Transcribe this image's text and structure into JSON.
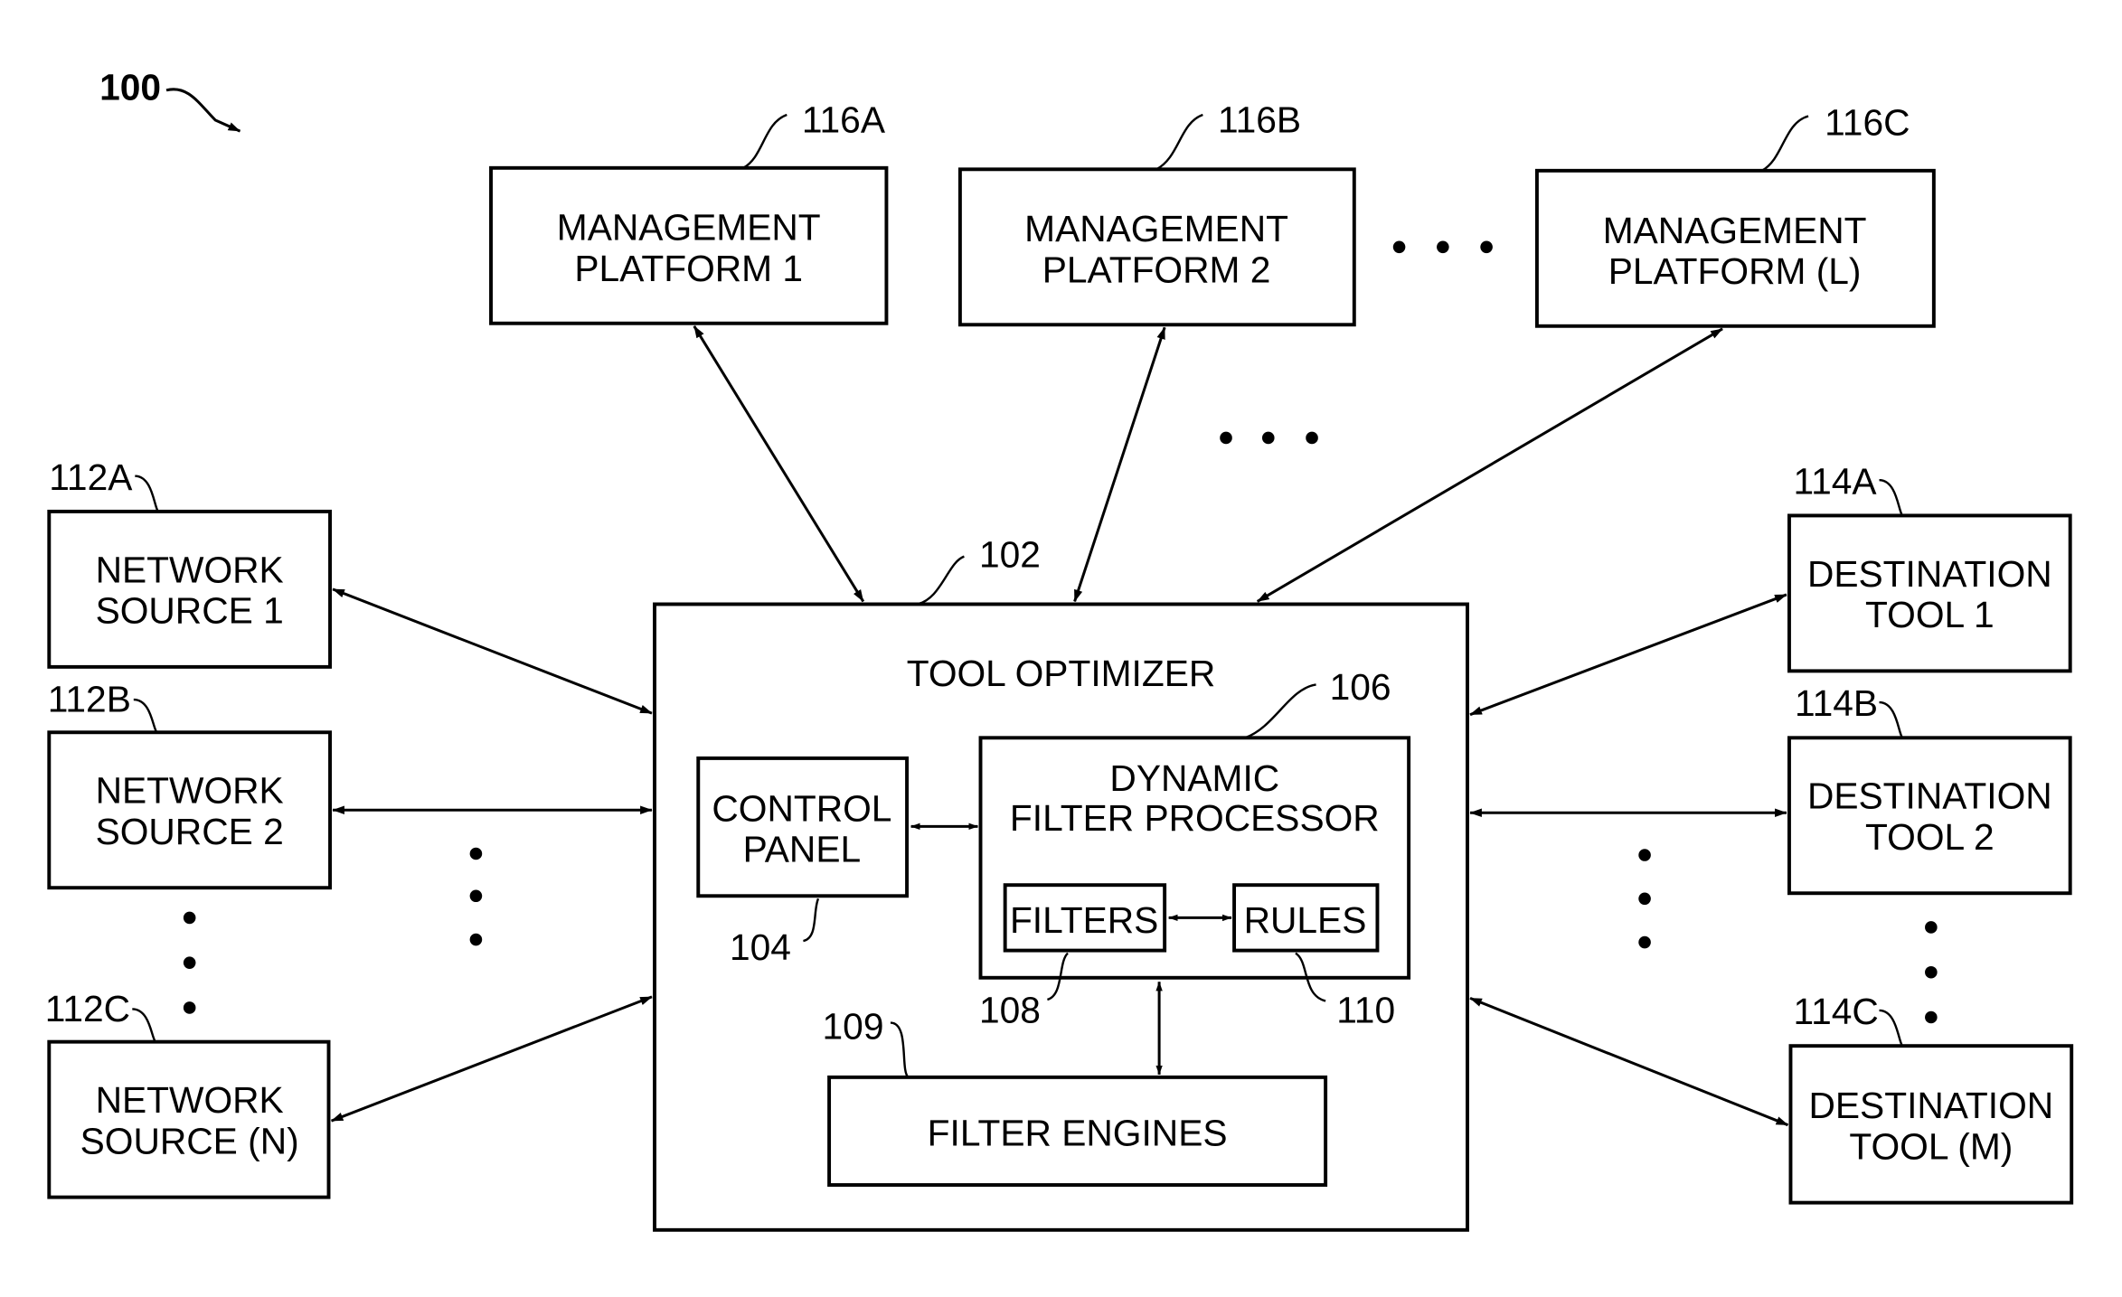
{
  "figure": {
    "ref": "100",
    "colors": {
      "stroke": "#000000",
      "background": "#ffffff"
    }
  },
  "management_platforms": [
    {
      "ref": "116A",
      "line1": "MANAGEMENT",
      "line2": "PLATFORM 1"
    },
    {
      "ref": "116B",
      "line1": "MANAGEMENT",
      "line2": "PLATFORM 2"
    },
    {
      "ref": "116C",
      "line1": "MANAGEMENT",
      "line2": "PLATFORM (L)"
    }
  ],
  "network_sources": [
    {
      "ref": "112A",
      "line1": "NETWORK",
      "line2": "SOURCE 1"
    },
    {
      "ref": "112B",
      "line1": "NETWORK",
      "line2": "SOURCE 2"
    },
    {
      "ref": "112C",
      "line1": "NETWORK",
      "line2": "SOURCE (N)"
    }
  ],
  "destination_tools": [
    {
      "ref": "114A",
      "line1": "DESTINATION",
      "line2": "TOOL 1"
    },
    {
      "ref": "114B",
      "line1": "DESTINATION",
      "line2": "TOOL 2"
    },
    {
      "ref": "114C",
      "line1": "DESTINATION",
      "line2": "TOOL (M)"
    }
  ],
  "tool_optimizer": {
    "ref": "102",
    "title": "TOOL OPTIMIZER",
    "control_panel": {
      "ref": "104",
      "line1": "CONTROL",
      "line2": "PANEL"
    },
    "dynamic_filter_processor": {
      "ref": "106",
      "line1": "DYNAMIC",
      "line2": "FILTER PROCESSOR",
      "filters": {
        "ref": "108",
        "label": "FILTERS"
      },
      "rules": {
        "ref": "110",
        "label": "RULES"
      }
    },
    "filter_engines": {
      "ref": "109",
      "label": "FILTER ENGINES"
    }
  }
}
